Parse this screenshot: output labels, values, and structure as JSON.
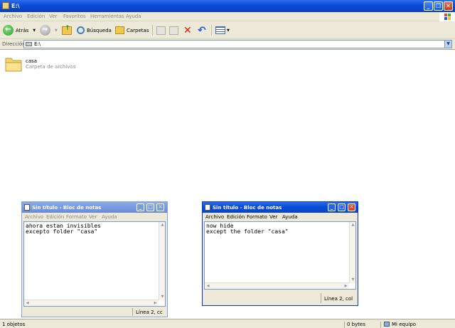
{
  "explorer": {
    "title": "E:\\",
    "menu": [
      "Archivo",
      "Edición",
      "Ver",
      "Favoritos",
      "Herramientas",
      "Ayuda"
    ],
    "toolbar": {
      "back": "Atrás",
      "search": "Búsqueda",
      "folders": "Carpetas"
    },
    "address": {
      "label": "Dirección",
      "value": "E:\\"
    },
    "folder": {
      "name": "casa",
      "type": "Carpeta de archivos"
    },
    "status": {
      "objects": "1 objetos",
      "size": "0 bytes",
      "location": "Mi equipo"
    }
  },
  "notepad1": {
    "title": "Sin título - Bloc de notas",
    "menu": [
      "Archivo",
      "Edición",
      "Formato",
      "Ver",
      "Ayuda"
    ],
    "text": "ahora estan invisibles\nexcepto folder \"casa\"",
    "status": "Línea 2, cc"
  },
  "notepad2": {
    "title": "Sin título - Bloc de notas",
    "menu": [
      "Archivo",
      "Edición",
      "Formato",
      "Ver",
      "Ayuda"
    ],
    "text": "now hide\nexcept the folder \"casa\"",
    "status": "Línea 2, col"
  },
  "colors": {
    "titlebar": "#0a4bd8",
    "chrome": "#ece9d8",
    "close": "#c03a20"
  }
}
